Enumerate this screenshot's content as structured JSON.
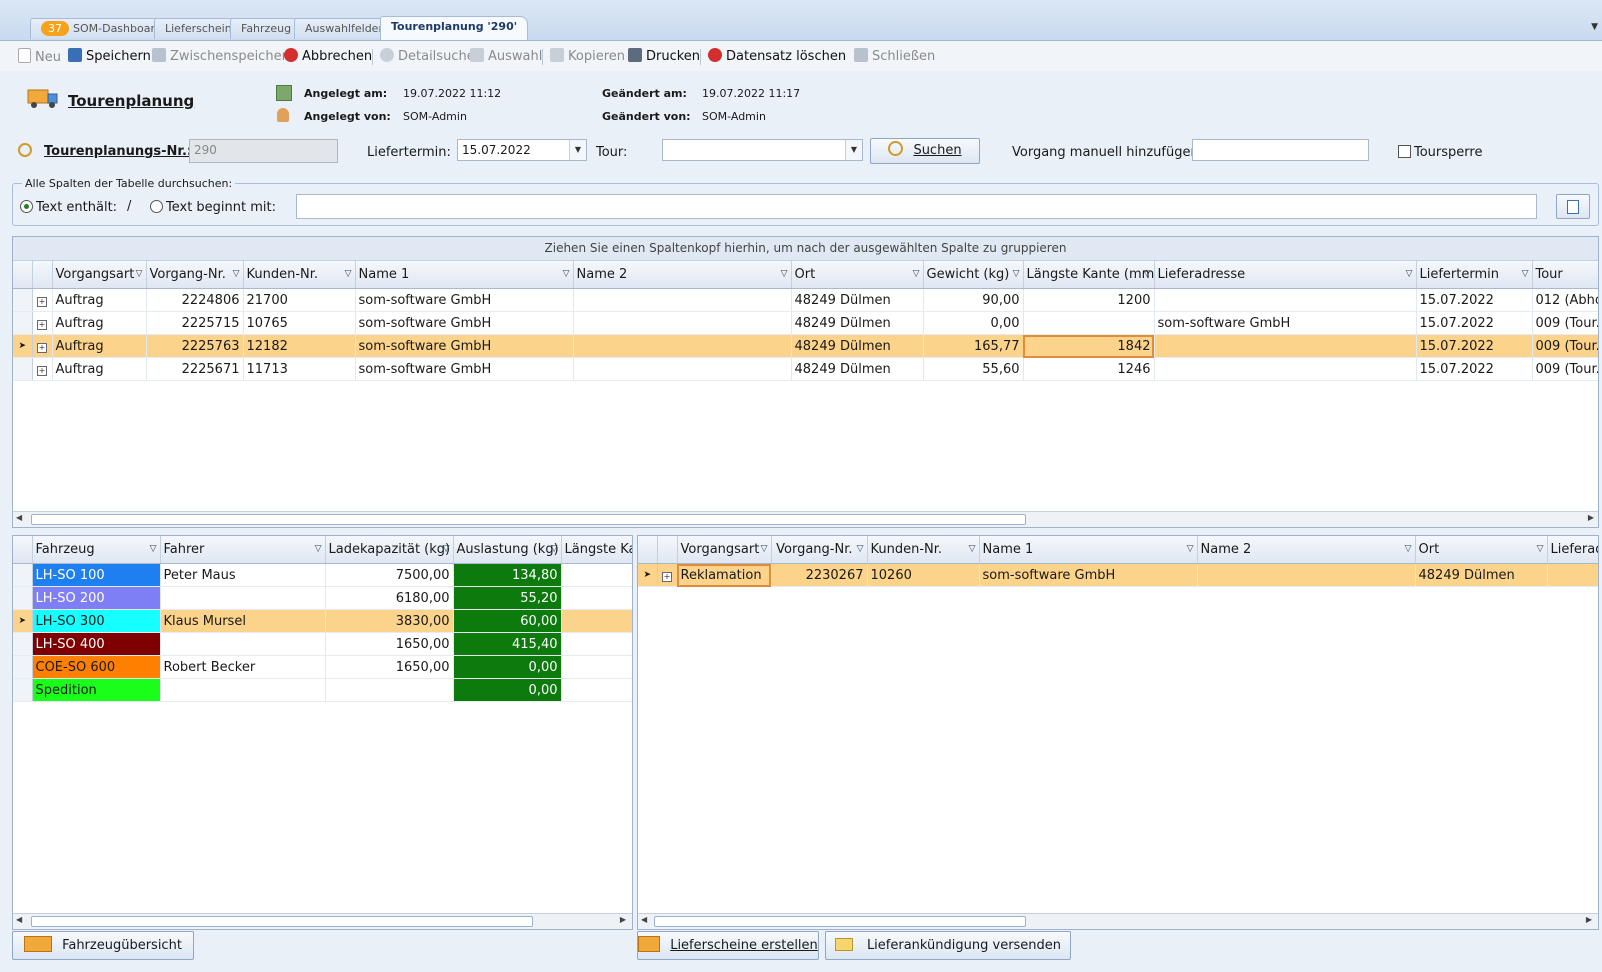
{
  "tabs": [
    {
      "badge": "37",
      "label": "SOM-Dashboard"
    },
    {
      "label": "Lieferschein"
    },
    {
      "label": "Fahrzeug"
    },
    {
      "label": "Auswahlfelder"
    },
    {
      "label": "Tourenplanung '290'"
    }
  ],
  "toolbar": {
    "neu": "Neu",
    "speichern": "Speichern",
    "zwischenspeichern": "Zwischenspeichern",
    "abbrechen": "Abbrechen",
    "detailsuche": "Detailsuche",
    "auswahl": "Auswahl",
    "kopieren": "Kopieren",
    "drucken": "Drucken",
    "loeschen": "Datensatz löschen",
    "schliessen": "Schließen"
  },
  "header": {
    "title": "Tourenplanung",
    "angelegt_am_label": "Angelegt am:",
    "angelegt_am": "19.07.2022 11:12",
    "angelegt_von_label": "Angelegt von:",
    "angelegt_von": "SOM-Admin",
    "geaendert_am_label": "Geändert am:",
    "geaendert_am": "19.07.2022 11:17",
    "geaendert_von_label": "Geändert von:",
    "geaendert_von": "SOM-Admin"
  },
  "form": {
    "nr_label": "Tourenplanungs-Nr.:",
    "nr_value": "290",
    "liefertermin_label": "Liefertermin:",
    "liefertermin_value": "15.07.2022",
    "tour_label": "Tour:",
    "tour_value": "",
    "suchen": "Suchen",
    "vorgang_label": "Vorgang manuell hinzufügen:",
    "vorgang_value": "",
    "toursperre": "Toursperre"
  },
  "search": {
    "caption": "Alle Spalten der Tabelle durchsuchen:",
    "opt1": "Text enthält:",
    "slash": "/",
    "opt2": "Text beginnt mit:",
    "value": ""
  },
  "top_grid": {
    "group_hint": "Ziehen Sie einen Spaltenkopf hierhin, um nach der ausgewählten Spalte zu gruppieren",
    "columns": [
      "Vorgangsart",
      "Vorgang-Nr.",
      "Kunden-Nr.",
      "Name 1",
      "Name 2",
      "Ort",
      "Gewicht (kg)",
      "Längste Kante (mm)",
      "Lieferadresse",
      "Liefertermin",
      "Tour"
    ],
    "rows": [
      [
        "Auftrag",
        "2224806",
        "21700",
        "som-software GmbH",
        "",
        "48249 Dülmen",
        "90,00",
        "1200",
        "",
        "15.07.2022",
        "012 (Abho"
      ],
      [
        "Auftrag",
        "2225715",
        "10765",
        "som-software GmbH",
        "",
        "48249 Dülmen",
        "0,00",
        "",
        "som-software GmbH",
        "15.07.2022",
        "009 (Tour..."
      ],
      [
        "Auftrag",
        "2225763",
        "12182",
        "som-software GmbH",
        "",
        "48249 Dülmen",
        "165,77",
        "1842",
        "",
        "15.07.2022",
        "009 (Tour..."
      ],
      [
        "Auftrag",
        "2225671",
        "11713",
        "som-software GmbH",
        "",
        "48249 Dülmen",
        "55,60",
        "1246",
        "",
        "15.07.2022",
        "009 (Tour..."
      ]
    ]
  },
  "vehicle_grid": {
    "columns": [
      "Fahrzeug",
      "Fahrer",
      "Ladekapazität (kg)",
      "Auslastung (kg)",
      "Längste Ka"
    ],
    "rows": [
      {
        "fahrzeug": "LH-SO 100",
        "color": "#1e7ff0",
        "fg": "#ffffff",
        "fahrer": "Peter Maus",
        "kap": "7500,00",
        "last": "134,80"
      },
      {
        "fahrzeug": "LH-SO 200",
        "color": "#7f7ff5",
        "fg": "#ffffff",
        "fahrer": "",
        "kap": "6180,00",
        "last": "55,20"
      },
      {
        "fahrzeug": "LH-SO 300",
        "color": "#15ffff",
        "fg": "#1a1a1a",
        "fahrer": "Klaus Mursel",
        "kap": "3830,00",
        "last": "60,00"
      },
      {
        "fahrzeug": "LH-SO 400",
        "color": "#7f0000",
        "fg": "#ffffff",
        "fahrer": "",
        "kap": "1650,00",
        "last": "415,40"
      },
      {
        "fahrzeug": "COE-SO 600",
        "color": "#ff8000",
        "fg": "#1a1a1a",
        "fahrer": "Robert Becker",
        "kap": "1650,00",
        "last": "0,00"
      },
      {
        "fahrzeug": "Spedition",
        "color": "#1aff1a",
        "fg": "#1a1a1a",
        "fahrer": "",
        "kap": "",
        "last": "0,00"
      }
    ]
  },
  "detail_grid": {
    "columns": [
      "Vorgangsart",
      "Vorgang-Nr.",
      "Kunden-Nr.",
      "Name 1",
      "Name 2",
      "Ort",
      "Lieferad"
    ],
    "rows": [
      [
        "Reklamation",
        "2230267",
        "10260",
        "som-software GmbH",
        "",
        "48249 Dülmen",
        ""
      ]
    ]
  },
  "bottom_buttons": {
    "fahrzeuguebersicht": "Fahrzeugübersicht",
    "lieferscheine": "Lieferscheine erstellen",
    "lieferankuendigung": "Lieferankündigung versenden"
  },
  "colors": {
    "accent": "#fbd38b",
    "load_green": "#0c7a0c",
    "badge": "#f7a21b"
  }
}
